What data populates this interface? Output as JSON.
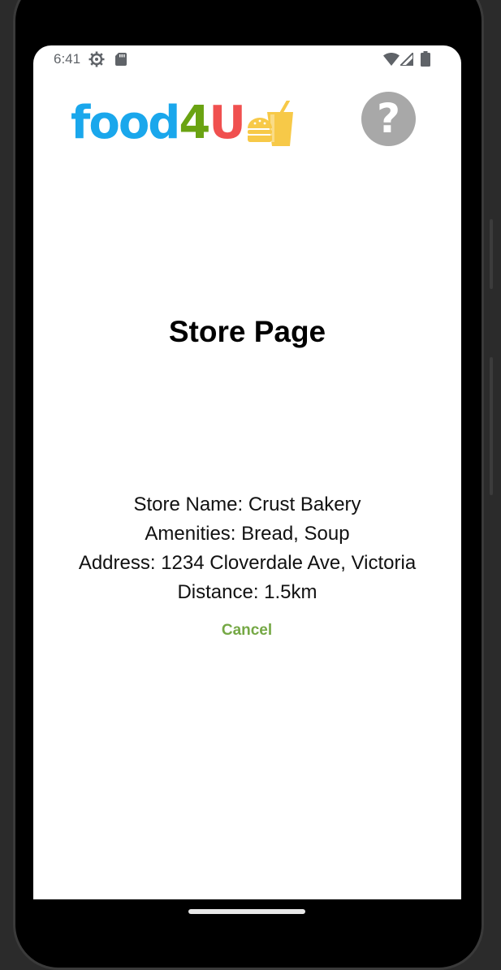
{
  "status_bar": {
    "time": "6:41",
    "icons": [
      "settings-gear-icon",
      "sd-card-icon",
      "wifi-icon",
      "signal-icon",
      "battery-icon"
    ]
  },
  "header": {
    "logo": {
      "part1": "food",
      "part2": "4",
      "part3": "U",
      "colors": {
        "food": "#1aa7ec",
        "four": "#6aa312",
        "u": "#f0504f",
        "mark": "#f7c948"
      }
    },
    "help_button_label": "?"
  },
  "main": {
    "title": "Store Page",
    "store_info": {
      "name_line": "Store Name: Crust Bakery",
      "amenities_line": "Amenities: Bread, Soup",
      "address_line": "Address: 1234 Cloverdale Ave, Victoria",
      "distance_line": "Distance: 1.5km"
    },
    "cancel_label": "Cancel"
  },
  "colors": {
    "accent_green": "#75a845",
    "help_gray": "#a8a8a8"
  }
}
